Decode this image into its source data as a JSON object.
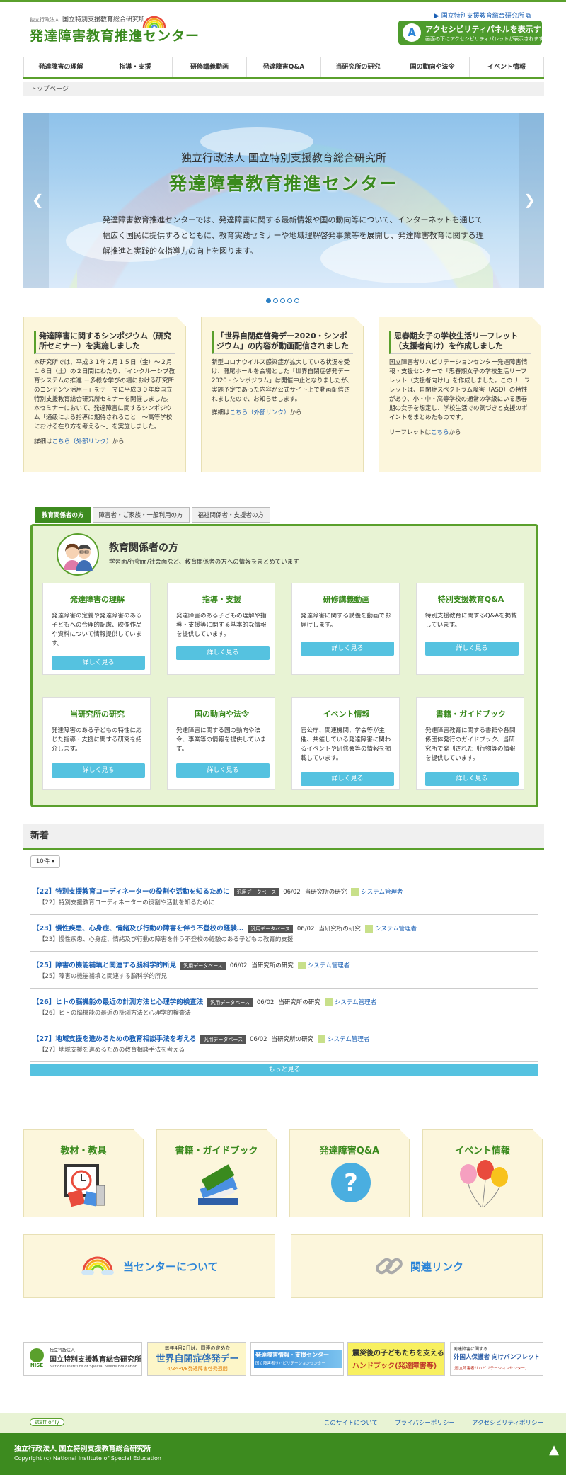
{
  "header": {
    "org_tag": "独立行政法人",
    "org_name": "国立特別支援教育総合研究所",
    "site_name": "発達障害教育推進センター",
    "ext_link": "国立特別支援教育総合研究所",
    "accessibility_title": "アクセシビリティパネルを表示する",
    "accessibility_sub": "画面の下にアクセシビリティパレットが表示されます"
  },
  "nav": [
    "発達障害の理解",
    "指導・支援",
    "研修講義動画",
    "発達障害Q&A",
    "当研究所の研究",
    "国の動向や法令",
    "イベント情報"
  ],
  "breadcrumb": "トップページ",
  "hero": {
    "line1": "独立行政法人 国立特別支援教育総合研究所",
    "line2": "発達障害教育推進センター",
    "desc": "発達障害教育推進センターでは、発達障害に関する最新情報や国の動向等について、インターネットを通じて幅広く国民に提供するとともに、教育実践セミナーや地域理解啓発事業等を展開し、発達障害教育に関する理解推進と実践的な指導力の向上を図ります。",
    "slides": 5,
    "active_slide": 0
  },
  "notices": [
    {
      "title": "発達障害に関するシンポジウム（研究所セミナー）を実施しました",
      "body": "本研究所では、平成３１年２月１５日（金）～２月１６日（土）の２日間にわたり、「インクルーシブ教育システムの推進 －多様な学びの場における研究所のコンテンツ活用－」をテーマに平成３０年度国立特別支援教育総合研究所セミナーを開催しました。　本セミナーにおいて、発達障害に関するシンポジウム「通級による指導に期待されること　～高等学校における在り方を考える～」を実施しました。",
      "more_prefix": "詳細は",
      "more_link": "こちら（外部リンク）",
      "more_suffix": "から"
    },
    {
      "title": "「世界自閉症啓発デー2020・シンポジウム」の内容が動画配信されました",
      "body": "新型コロナウイルス感染症が拡大している状況を受け、灘尾ホールを会場とした「世界自閉症啓発デー2020・シンポジウム」は開催中止となりましたが、実施予定であった内容が公式サイト上で動画配信されましたので、お知らせします。",
      "more_prefix": "詳細は",
      "more_link": "こちら（外部リンク）",
      "more_suffix": "から"
    },
    {
      "title": "思春期女子の学校生活リーフレット（支援者向け）を作成しました",
      "body": "国立障害者リハビリテーションセンター発達障害情報・支援センターで「思春期女子の学校生活リーフレット（支援者向け）」を作成しました。このリーフレットは、自閉症スペクトラム障害（ASD）の特性があり、小・中・高等学校の通常の学級にいる思春期の女子を想定し、学校生活での気づきと支援のポイントをまとめたものです。",
      "more_prefix": "リーフレットは",
      "more_link": "こちら",
      "more_suffix": "から"
    }
  ],
  "tabs": [
    "教育関係者の方",
    "障害者・ご家族・一般利用の方",
    "福祉関係者・支援者の方"
  ],
  "panel": {
    "title": "教育関係者の方",
    "subtitle": "学習面/行動面/社会面など、教育関係者の方への情報をまとめています",
    "cards": [
      {
        "title": "発達障害の理解",
        "desc": "発達障害の定義や発達障害のある子どもへの合理的配慮、映像作品や資料について情報提供しています。",
        "button": "詳しく見る"
      },
      {
        "title": "指導・支援",
        "desc": "発達障害のある子どもの理解や指導・支援等に関する基本的な情報を提供しています。",
        "button": "詳しく見る"
      },
      {
        "title": "研修講義動画",
        "desc": "発達障害に関する講義を動画でお届けします。",
        "button": "詳しく見る"
      },
      {
        "title": "特別支援教育Q&A",
        "desc": "特別支援教育に関するQ&Aを掲載しています。",
        "button": "詳しく見る"
      },
      {
        "title": "当研究所の研究",
        "desc": "発達障害のある子どもの特性に応じた指導・支援に関する研究を紹介します。",
        "button": "詳しく見る"
      },
      {
        "title": "国の動向や法令",
        "desc": "発達障害に関する国の動向や法令、事業等の情報を提供しています。",
        "button": "詳しく見る"
      },
      {
        "title": "イベント情報",
        "desc": "官公庁、関連機関、学会等が主催、共催している発達障害に関わるイベントや研修会等の情報を掲載しています。",
        "button": "詳しく見る"
      },
      {
        "title": "書籍・ガイドブック",
        "desc": "発達障害教育に関する書籍や各関係団体発行のガイドブック、当研究所で発刊された刊行物等の情報を提供しています。",
        "button": "詳しく見る"
      }
    ]
  },
  "news": {
    "heading": "新着",
    "count_label": "10件 ▾",
    "items": [
      {
        "title": "【22】特別支援教育コーディネーターの役割や活動を知るために",
        "badge": "汎用データベース",
        "date": "06/02",
        "category": "当研究所の研究",
        "user": "システム管理者",
        "sub": "【22】特別支援教育コーディネーターの役割や活動を知るために"
      },
      {
        "title": "【23】慢性疾患、心身症、情緒及び行動の障害を伴う不登校の経験…",
        "badge": "汎用データベース",
        "date": "06/02",
        "category": "当研究所の研究",
        "user": "システム管理者",
        "sub": "【23】慢性疾患、心身症、情緒及び行動の障害を伴う不登校の経験のある子どもの教育的支援"
      },
      {
        "title": "【25】障害の機能補填と関連する脳科学的所見",
        "badge": "汎用データベース",
        "date": "06/02",
        "category": "当研究所の研究",
        "user": "システム管理者",
        "sub": "【25】障害の機能補填と関連する脳科学的所見"
      },
      {
        "title": "【26】ヒトの脳機能の最近の計測方法と心理学的検査法",
        "badge": "汎用データベース",
        "date": "06/02",
        "category": "当研究所の研究",
        "user": "システム管理者",
        "sub": "【26】ヒトの脳機能の最近の計測方法と心理学的検査法"
      },
      {
        "title": "【27】地域支援を進めるための教育相談手法を考える",
        "badge": "汎用データベース",
        "date": "06/02",
        "category": "当研究所の研究",
        "user": "システム管理者",
        "sub": "【27】地域支援を進めるための教育相談手法を考える"
      }
    ],
    "more": "もっと見る"
  },
  "tiles": [
    {
      "title": "教材・教具",
      "icon": "teaching-materials-icon"
    },
    {
      "title": "書籍・ガイドブック",
      "icon": "books-icon"
    },
    {
      "title": "発達障害Q&A",
      "icon": "question-icon"
    },
    {
      "title": "イベント情報",
      "icon": "balloons-icon"
    }
  ],
  "wide_tiles": [
    {
      "title": "当センターについて",
      "icon": "rainbow-icon"
    },
    {
      "title": "関連リンク",
      "icon": "link-icon"
    }
  ],
  "banners": {
    "b1_small": "独立行政法人",
    "b1_name": "国立特別支援教育総合研究所",
    "b1_en": "National Institute of Special Needs Education",
    "b1_logo": "NISE",
    "b2_top": "毎年4月2日は、国連の定めた",
    "b2_main": "世界自閉症啓発デー",
    "b2_sub": "4/2〜4/8発達障害啓発週間",
    "b3_main": "発達障害情報・支援センター",
    "b3_sub": "国立障害者リハビリテーションセンター",
    "b4_line1": "震災後の子どもたちを支える",
    "b4_line2": "ハンドブック(発達障害等)",
    "b5_line1": "発達障害に関する",
    "b5_line2": "外国人保護者 向けパンフレット",
    "b5_line3": "(国立障害者リハビリテーションセンター)"
  },
  "footer": {
    "staff": "staff only",
    "links": [
      "このサイトについて",
      "プライバシーポリシー",
      "アクセシビリティポリシー"
    ],
    "name": "独立行政法人 国立特別支援教育総合研究所",
    "copyright": "Copyright (c) National Institute of Special Education"
  },
  "colors": {
    "brand_green": "#3a8a1e",
    "accent_blue": "#55c2e0",
    "link_blue": "#1a5fb4",
    "notice_bg": "#fcf6dc"
  }
}
